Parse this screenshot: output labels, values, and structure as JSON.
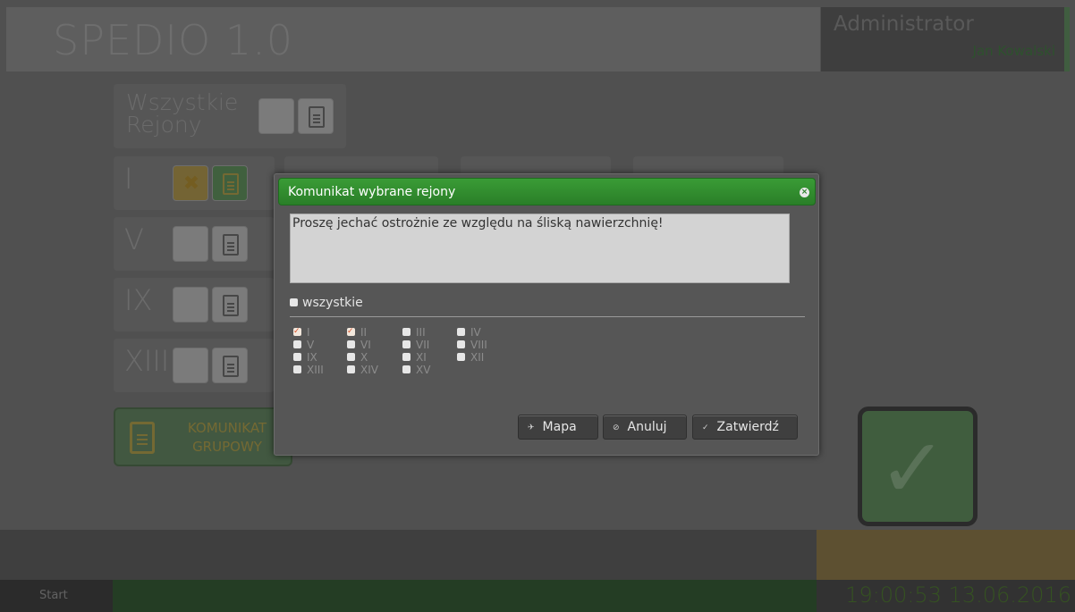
{
  "app": {
    "title": "SPEDIO 1.0",
    "user_role": "Administrator",
    "user_name": "Jan Kowalski"
  },
  "regions_panel": {
    "all_label_line1": "Wszystkie",
    "all_label_line2": "Rejony",
    "tiles": [
      {
        "label": "I",
        "state": "selected"
      },
      {
        "label": "V",
        "state": "normal"
      },
      {
        "label": "IX",
        "state": "normal"
      },
      {
        "label": "XIII",
        "state": "normal"
      }
    ],
    "group_message_line1": "KOMUNIKAT",
    "group_message_line2": "GRUPOWY"
  },
  "taskbar": {
    "start_label": "Start",
    "clock": "19:00:53 13.06.2016"
  },
  "dialog": {
    "title": "Komunikat wybrane rejony",
    "close_icon": "close-icon",
    "message": "Proszę jechać ostrożnie ze względu na śliską nawierzchnię!",
    "select_all_label": "wszystkie",
    "select_all_checked": false,
    "regions": [
      {
        "label": "I",
        "checked": true
      },
      {
        "label": "II",
        "checked": true
      },
      {
        "label": "III",
        "checked": false
      },
      {
        "label": "IV",
        "checked": false
      },
      {
        "label": "V",
        "checked": false
      },
      {
        "label": "VI",
        "checked": false
      },
      {
        "label": "VII",
        "checked": false
      },
      {
        "label": "VIII",
        "checked": false
      },
      {
        "label": "IX",
        "checked": false
      },
      {
        "label": "X",
        "checked": false
      },
      {
        "label": "XI",
        "checked": false
      },
      {
        "label": "XII",
        "checked": false
      },
      {
        "label": "XIII",
        "checked": false
      },
      {
        "label": "XIV",
        "checked": false
      },
      {
        "label": "XV",
        "checked": false
      }
    ],
    "buttons": {
      "map_label": "Mapa",
      "cancel_label": "Anuluj",
      "confirm_label": "Zatwierdź"
    }
  },
  "colors": {
    "dialog_header": "#2a8a27",
    "accent_green": "#6fa06c",
    "check_mark": "#d9532b"
  }
}
